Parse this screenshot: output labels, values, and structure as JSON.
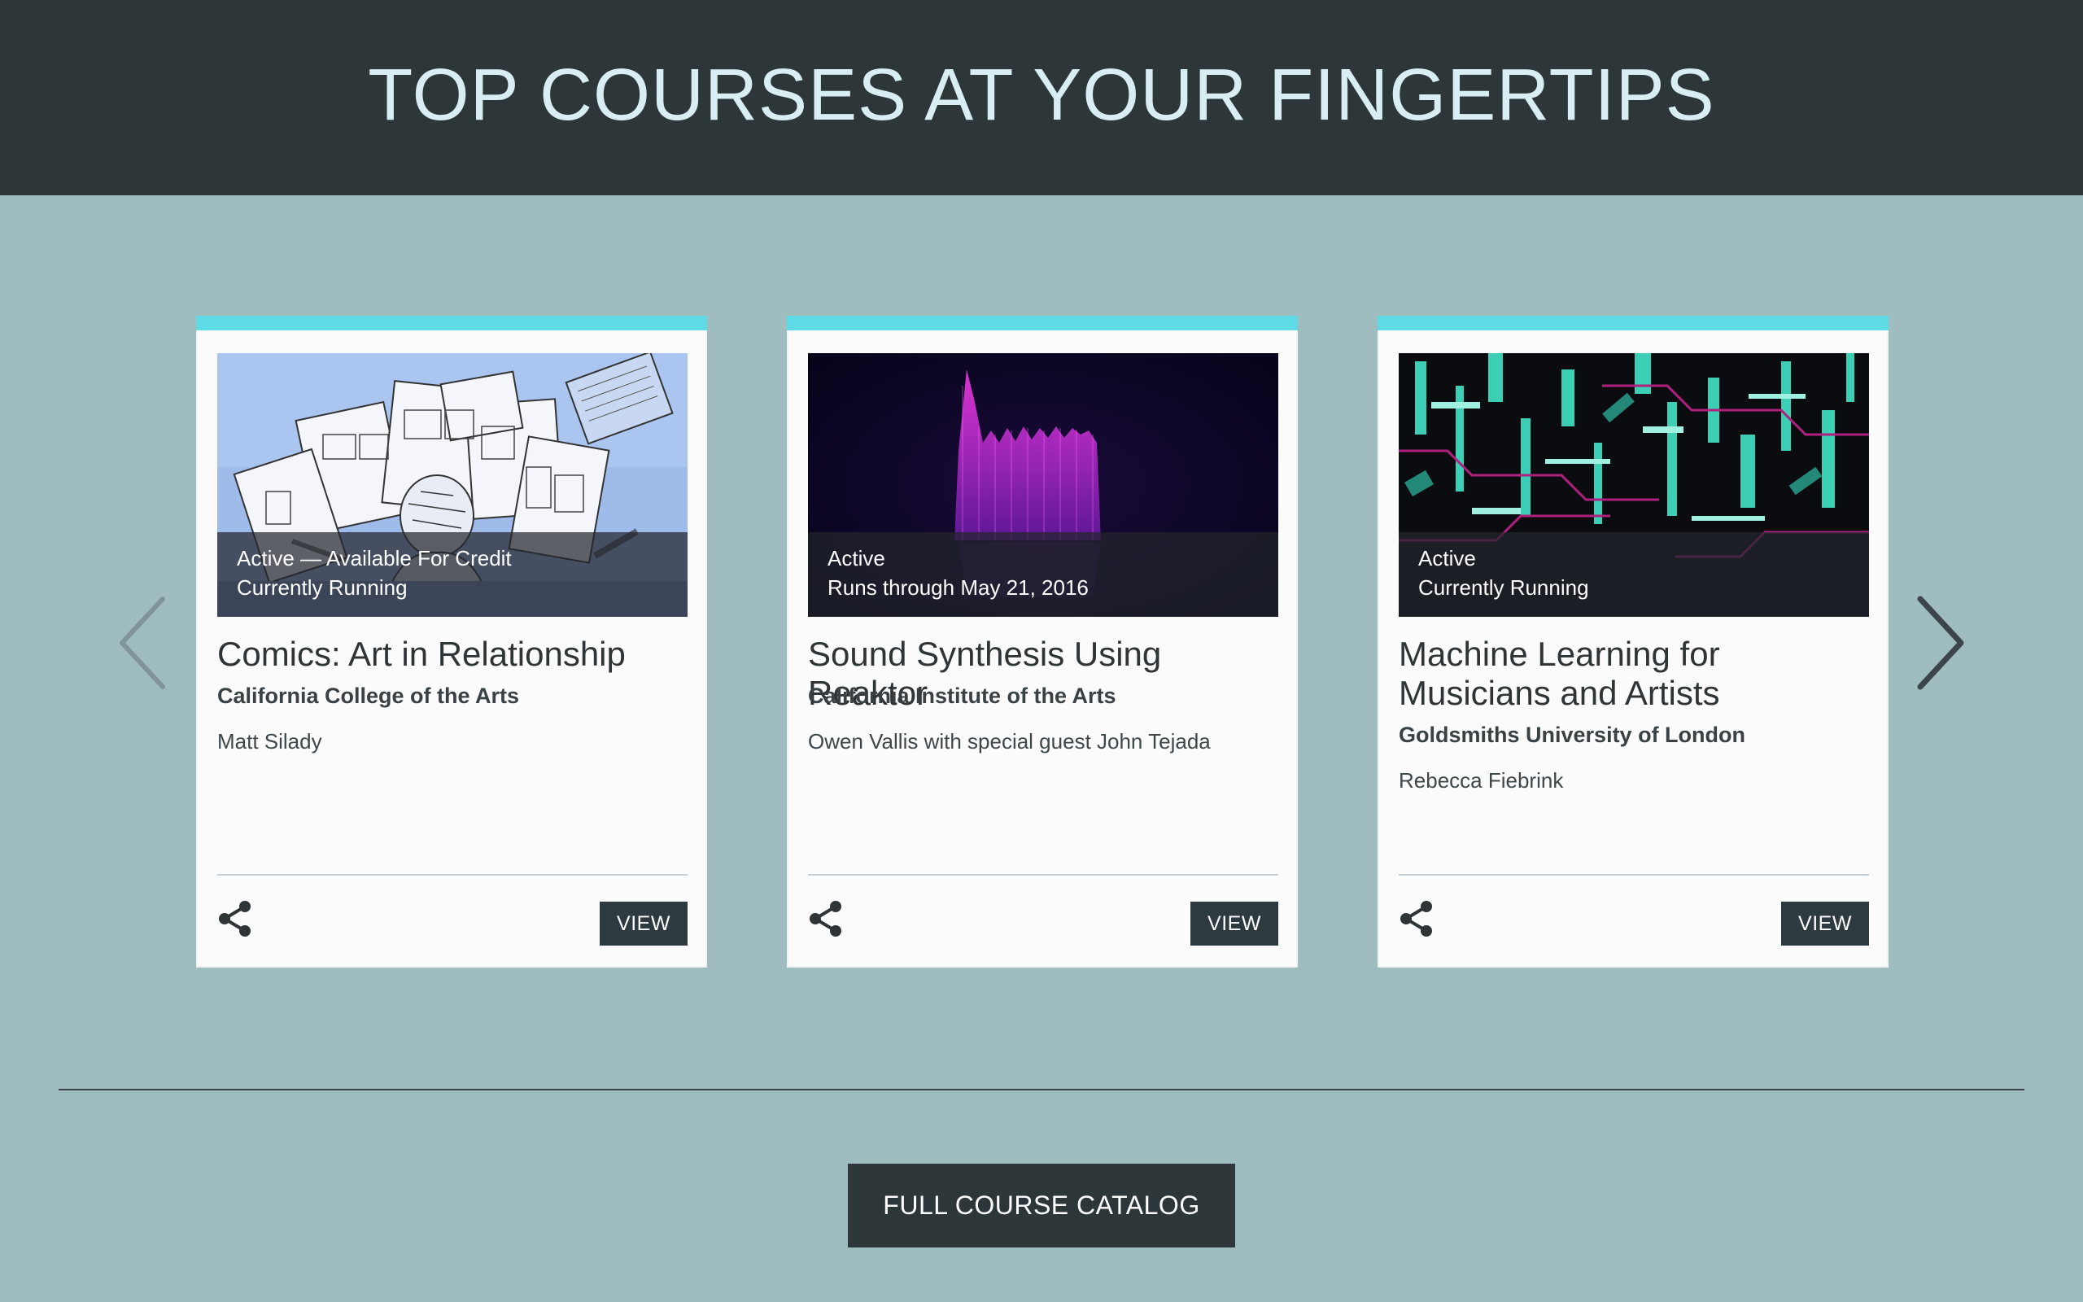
{
  "header": {
    "title": "TOP COURSES AT YOUR FINGERTIPS"
  },
  "carousel": {
    "prev_icon": "chevron-left-icon",
    "next_icon": "chevron-right-icon"
  },
  "courses": [
    {
      "status_line1": "Active — Available For Credit",
      "status_line2": "Currently Running",
      "title": "Comics: Art in Relationship",
      "school": "California College of the Arts",
      "instructor": "Matt Silady",
      "view_label": "VIEW",
      "share_icon": "share-icon"
    },
    {
      "status_line1": "Active",
      "status_line2": "Runs through May 21, 2016",
      "title": "Sound Synthesis Using Reaktor",
      "school": "California Institute of the Arts",
      "instructor": "Owen Vallis with special guest John Tejada",
      "view_label": "VIEW",
      "share_icon": "share-icon"
    },
    {
      "status_line1": "Active",
      "status_line2": "Currently Running",
      "title": "Machine Learning for Musicians and Artists",
      "school": "Goldsmiths University of London",
      "instructor": "Rebecca Fiebrink",
      "view_label": "VIEW",
      "share_icon": "share-icon"
    }
  ],
  "footer": {
    "catalog_button_label": "FULL COURSE CATALOG"
  },
  "colors": {
    "header_bg": "#2d3639",
    "page_bg": "#9fbcbf",
    "card_accent": "#5fdbe6",
    "button_bg": "#2d3a40"
  }
}
